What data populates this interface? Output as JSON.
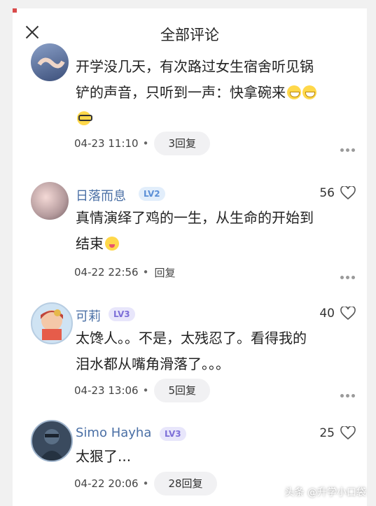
{
  "header": {
    "title": "全部评论"
  },
  "comments": [
    {
      "name": "",
      "level": "",
      "likes": "",
      "text1": "开学没几天，有次路过女生宿舍听见锅",
      "text2": "铲的声音，只听到一声：快拿碗来",
      "time": "04-23 11:10",
      "reply": "3回复",
      "emoji_names": [
        "grin-icon",
        "grin-icon",
        "glasses-icon"
      ]
    },
    {
      "name": "日落而息",
      "level": "LV2",
      "likes": "56",
      "text1": "真情演绎了鸡的一生，从生命的开始到",
      "text2": "结束",
      "time": "04-22 22:56",
      "reply": "回复"
    },
    {
      "name": "可莉",
      "level": "LV3",
      "likes": "40",
      "text1": "太馋人。。不是，太残忍了。看得我的",
      "text2": "泪水都从嘴角滑落了。。。",
      "time": "04-23 13:06",
      "reply": "5回复"
    },
    {
      "name": "Simo Hayha",
      "level": "LV3",
      "likes": "25",
      "text1": "太狠了...",
      "time": "04-22 20:06",
      "reply": "28回复"
    }
  ],
  "watermark": "头条 @升学小口袋",
  "colors": {
    "username": "#4a6fa5",
    "level_badge": "#7d6fd8",
    "level_badge_lv2": "#5b8fd6"
  }
}
